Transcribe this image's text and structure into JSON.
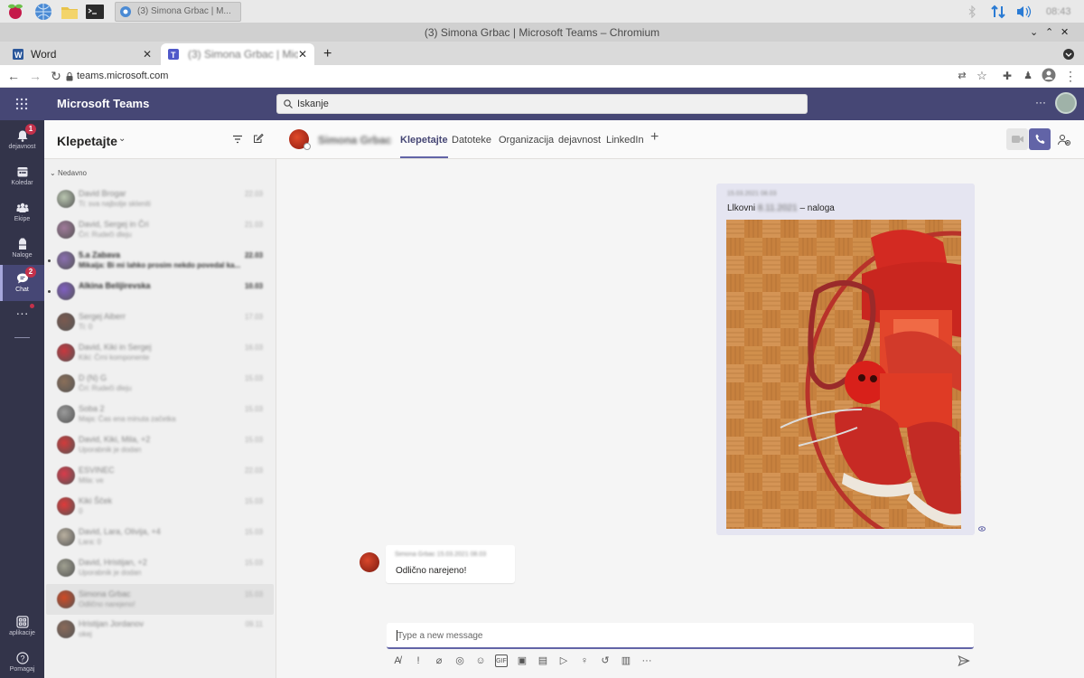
{
  "os": {
    "task_title": "(3) Simona Grbac | M...",
    "clock": "08:43"
  },
  "window": {
    "title": "(3) Simona Grbac | Microsoft Teams – Chromium"
  },
  "tabs": [
    {
      "label": "Word"
    },
    {
      "label": "(3) Simona Grbac | Micr"
    }
  ],
  "address": {
    "url": "teams.microsoft.com"
  },
  "teams": {
    "app_title": "Microsoft Teams",
    "search_placeholder": "Iskanje"
  },
  "rail": [
    {
      "label": "dejavnost",
      "badge": "1"
    },
    {
      "label": "Koledar"
    },
    {
      "label": "Ekipe"
    },
    {
      "label": "Naloge"
    },
    {
      "label": "Chat",
      "badge": "2"
    },
    {
      "label": "aplikacije"
    },
    {
      "label": "Pomagaj"
    }
  ],
  "chatlist": {
    "title": "Klepetajte",
    "section": "Nedavno",
    "items": [
      {
        "name": "David Brogar",
        "preview": "Ti: sva najbolje skleniti",
        "time": "22.03",
        "color": "#b9c6b0"
      },
      {
        "name": "David, Sergej in Čri",
        "preview": "Čri: Rudeči dleju",
        "time": "21.03",
        "color": "#a07a9a"
      },
      {
        "name": "5.a Zabava",
        "preview": "Mikaija: Bi mi lahko prosim nekdo povedal ka...",
        "time": "22.03",
        "color": "#8a6fb0",
        "unread": true
      },
      {
        "name": "Alkina Belijirevska",
        "preview": "",
        "time": "10.03",
        "color": "#7f5fc0",
        "unread": true
      },
      {
        "name": "Sergej Aiberr",
        "preview": "Ti: 0",
        "time": "17.03",
        "color": "#7a5a50"
      },
      {
        "name": "David, Kiki in Sergej",
        "preview": "Kiki: Črni komponente",
        "time": "16.03",
        "color": "#c9383f"
      },
      {
        "name": "D (N) G",
        "preview": "Čri: Rudeči dleju",
        "time": "15.03",
        "color": "#8a6f5a"
      },
      {
        "name": "Soba 2",
        "preview": "Maja: Čas ena minuta začetka",
        "time": "15.03",
        "color": "#9a9a9a"
      },
      {
        "name": "David, Kiki, Mila, +2",
        "preview": "Uporabnik je dodan",
        "time": "15.03",
        "color": "#d23b3b"
      },
      {
        "name": "ESVINEC",
        "preview": "Mila: ve",
        "time": "22.03",
        "color": "#d93b4a"
      },
      {
        "name": "Kiki Šček",
        "preview": "0",
        "time": "15.03",
        "color": "#e03a3a"
      },
      {
        "name": "David, Lara, Olivija, +4",
        "preview": "Lara: 0",
        "time": "15.03",
        "color": "#b9b0a0"
      },
      {
        "name": "David, Hristijan, +2",
        "preview": "Uporabnik je dodan",
        "time": "15.03",
        "color": "#a0a090"
      },
      {
        "name": "Simona Grbac",
        "preview": "Odlično narejeno!",
        "time": "15.03",
        "color": "#d04a25",
        "selected": true
      },
      {
        "name": "Hristijan Jordanov",
        "preview": "okej",
        "time": "09.11",
        "color": "#8a6a5a"
      }
    ]
  },
  "main": {
    "contact_name": "Simona Grbac",
    "tabs": [
      {
        "label": "Klepetajte",
        "active": true
      },
      {
        "label": "Datoteke"
      },
      {
        "label": "Organizacija"
      },
      {
        "label": "dejavnost"
      },
      {
        "label": "LinkedIn"
      }
    ],
    "message1": {
      "time": "15.03.2021 08.03",
      "text_prefix": "Llkovni",
      "text_blur": "8.11.2021",
      "text_suffix": "– naloga"
    },
    "message2": {
      "author": "Simona Grbac 15.03.2021 08.03",
      "text": "Odlično narejeno!"
    },
    "compose_placeholder": "Type a new message"
  },
  "colors": {
    "brand": "#464775",
    "accent": "#6264a7",
    "rail": "#33344a",
    "badge": "#c4314b"
  }
}
